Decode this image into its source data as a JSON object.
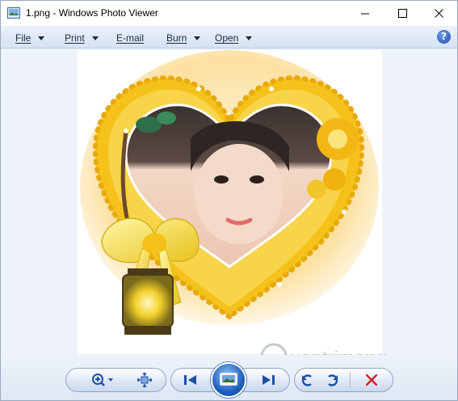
{
  "window": {
    "title": "1.png - Windows Photo Viewer",
    "icon": "photo-viewer-app-icon"
  },
  "menu": {
    "items": [
      {
        "label": "File"
      },
      {
        "label": "Print"
      },
      {
        "label": "E-mail"
      },
      {
        "label": "Burn"
      },
      {
        "label": "Open"
      }
    ],
    "help_label": "?"
  },
  "photo": {
    "description_icon": "heart-frame-portrait-image"
  },
  "toolbar": {
    "buttons": [
      "zoom-icon",
      "actual-size-icon",
      "previous-icon",
      "slideshow-icon",
      "next-icon",
      "rotate-counterclockwise-icon",
      "rotate-clockwise-icon",
      "delete-icon"
    ]
  },
  "watermark": {
    "text": "uantrimang"
  },
  "colors": {
    "accent": "#1d4fa8",
    "delete": "#d0222a",
    "frame_yellow": "#f5c21b"
  }
}
